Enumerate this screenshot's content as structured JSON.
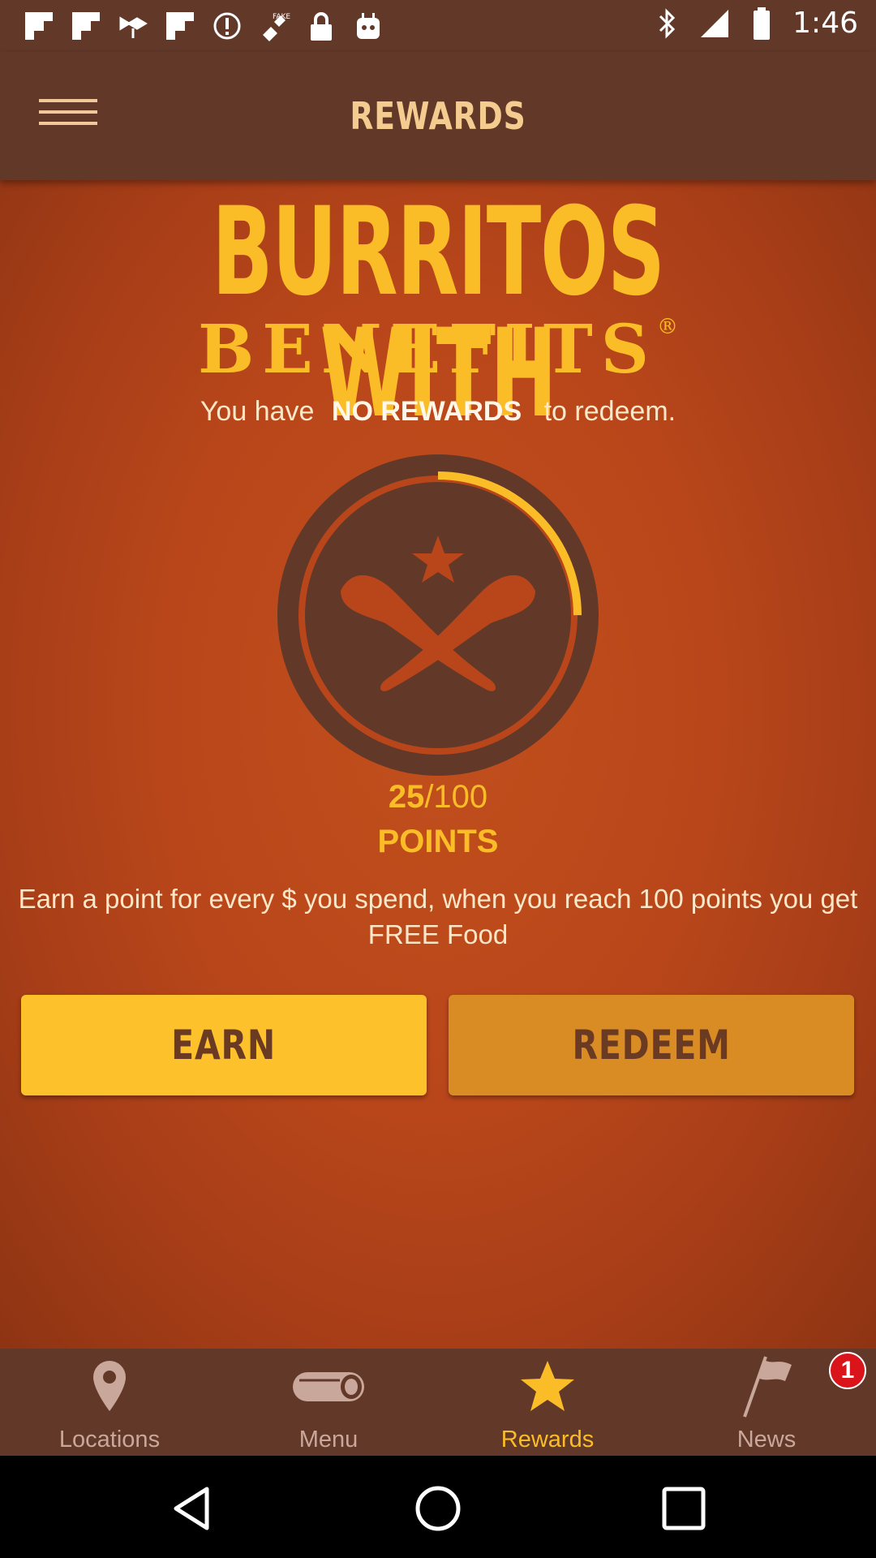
{
  "status_bar": {
    "time": "1:46",
    "icons": [
      "flipboard-icon",
      "flipboard-icon",
      "satellite-icon",
      "flipboard-icon",
      "alert-icon",
      "satellite-fake-icon",
      "lock-icon",
      "android-icon",
      "bluetooth-icon",
      "signal-icon",
      "battery-icon"
    ]
  },
  "app_bar": {
    "title": "REWARDS"
  },
  "hero": {
    "headline": "BURRITOS WITH",
    "subhead": "BENEFITS",
    "registered_mark": "®"
  },
  "rewards_status": {
    "prefix": "You have",
    "highlight": "NO REWARDS",
    "suffix": "to redeem."
  },
  "points": {
    "current": "25",
    "separator_total": "/100",
    "current_value": 25,
    "max_value": 100,
    "label": "POINTS"
  },
  "explanation": "Earn a point for every $ you spend, when you reach 100 points you get FREE Food",
  "actions": {
    "earn_label": "EARN",
    "redeem_label": "REDEEM"
  },
  "tabs": [
    {
      "label": "Locations",
      "icon": "location-pin-icon",
      "active": false
    },
    {
      "label": "Menu",
      "icon": "burrito-icon",
      "active": false
    },
    {
      "label": "Rewards",
      "icon": "star-icon",
      "active": true
    },
    {
      "label": "News",
      "icon": "flag-icon",
      "active": false
    }
  ],
  "news_badge": "1",
  "colors": {
    "brand_brown": "#623829",
    "accent_yellow": "#fbbd27",
    "background_orange": "#b8461a",
    "earn_button": "#fdc12c",
    "redeem_button": "#d98b24",
    "badge_red": "#d9151b"
  }
}
